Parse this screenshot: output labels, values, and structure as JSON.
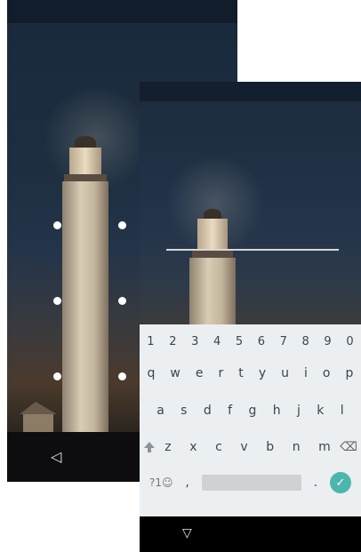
{
  "left_screen": {
    "nav": {
      "back_icon": "◁"
    }
  },
  "right_screen": {
    "keyboard": {
      "numbers": [
        "1",
        "2",
        "3",
        "4",
        "5",
        "6",
        "7",
        "8",
        "9",
        "0"
      ],
      "row1": [
        "q",
        "w",
        "e",
        "r",
        "t",
        "y",
        "u",
        "i",
        "o",
        "p"
      ],
      "row2": [
        "a",
        "s",
        "d",
        "f",
        "g",
        "h",
        "j",
        "k",
        "l"
      ],
      "row3": [
        "z",
        "x",
        "c",
        "v",
        "b",
        "n",
        "m"
      ],
      "symbols_key": "?1☺",
      "comma_key": ",",
      "period_key": ".",
      "enter_icon": "✓",
      "backspace_icon": "⌫"
    },
    "nav": {
      "back_icon": "▽"
    }
  },
  "colors": {
    "accent": "#4db6ac",
    "keyboard_bg": "#eceff1",
    "key_text": "#37474f"
  }
}
